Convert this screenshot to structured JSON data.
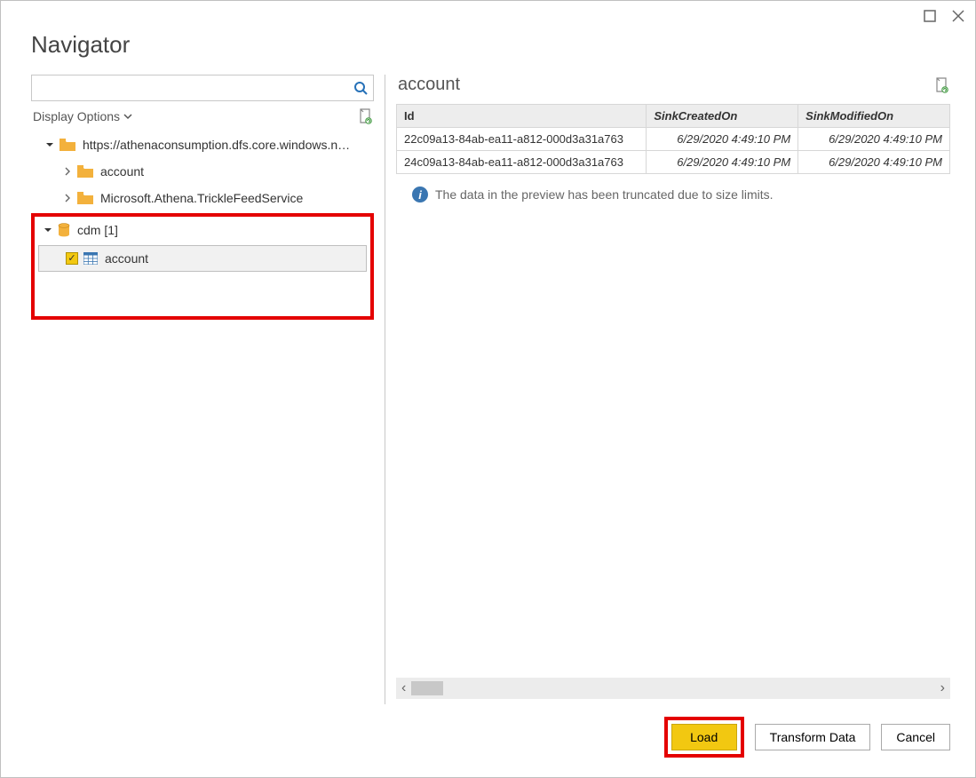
{
  "window": {
    "title": "Navigator"
  },
  "search": {
    "placeholder": ""
  },
  "left_pane": {
    "display_options_label": "Display Options",
    "tree": {
      "root": {
        "label": "https://athenaconsumption.dfs.core.windows.n…"
      },
      "account_folder": {
        "label": "account"
      },
      "tricklefeed_folder": {
        "label": "Microsoft.Athena.TrickleFeedService"
      },
      "cdm_db": {
        "label": "cdm [1]"
      },
      "account_table": {
        "label": "account"
      }
    }
  },
  "preview": {
    "title": "account",
    "columns": [
      "Id",
      "SinkCreatedOn",
      "SinkModifiedOn"
    ],
    "rows": [
      {
        "id": "22c09a13-84ab-ea11-a812-000d3a31a763",
        "created": "6/29/2020 4:49:10 PM",
        "modified": "6/29/2020 4:49:10 PM"
      },
      {
        "id": "24c09a13-84ab-ea11-a812-000d3a31a763",
        "created": "6/29/2020 4:49:10 PM",
        "modified": "6/29/2020 4:49:10 PM"
      }
    ],
    "info_message": "The data in the preview has been truncated due to size limits."
  },
  "buttons": {
    "load": "Load",
    "transform": "Transform Data",
    "cancel": "Cancel"
  }
}
